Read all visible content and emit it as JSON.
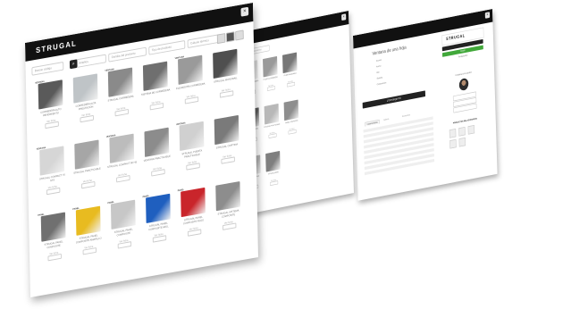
{
  "brand": {
    "logo_text": "STRUGAL",
    "close_glyph": "×"
  },
  "sheet1": {
    "filters": [
      "Buscar código",
      "Amplios",
      "Familia del producto",
      "Tipo de producto",
      "Cálculo térmico"
    ],
    "cards": [
      {
        "tag": "VENTANA",
        "name": "CORREDERA ALTO RENDIMIENTO",
        "sub": "Ver ficha",
        "color": "#5a5a5a"
      },
      {
        "tag": "",
        "name": "CORREDERA ALTA PRESTACIÓN",
        "sub": "Ver ficha",
        "color": "#bfc4c7"
      },
      {
        "tag": "VENTANA",
        "name": "STRUGAL CORREDERA",
        "sub": "Ver ficha",
        "color": "#8a8a8a"
      },
      {
        "tag": "",
        "name": "SISTEMA DE CORREDERA",
        "sub": "Ver ficha",
        "color": "#6f6f6f"
      },
      {
        "tag": "VENTANA",
        "name": "ELEVADORA CORREDERA",
        "sub": "Ver ficha",
        "color": "#9a9a9a"
      },
      {
        "tag": "",
        "name": "STRUGAL MONORAIL",
        "sub": "Ver ficha",
        "color": "#4f4f4f"
      },
      {
        "tag": "VENTANA",
        "name": "STRUGAL COMPACT 70 STS",
        "sub": "Ver ficha",
        "color": "#d6d6d6"
      },
      {
        "tag": "",
        "name": "STRUGAL PRACTICABLE",
        "sub": "Ver ficha",
        "color": "#a6a6a6"
      },
      {
        "tag": "VENTANA",
        "name": "STRUGAL COMPACT 80 HS",
        "sub": "Ver ficha",
        "color": "#bcbcbc"
      },
      {
        "tag": "",
        "name": "VENTANA PRACTICABLE",
        "sub": "Ver ficha",
        "color": "#8c8c8c"
      },
      {
        "tag": "VENTANA",
        "name": "STRUGAL PUERTA PRACTICABLE",
        "sub": "Ver ficha",
        "color": "#d0d0d0"
      },
      {
        "tag": "",
        "name": "STRUGAL CORTINA",
        "sub": "Ver ficha",
        "color": "#7a7a7a"
      },
      {
        "tag": "PANEL",
        "name": "STRUGAL PANEL COMPOSITE",
        "sub": "Ver ficha",
        "color": "#707070"
      },
      {
        "tag": "PANEL",
        "name": "STRUGAL PANEL COMPOSITE AMARILLO",
        "sub": "Ver ficha",
        "color": "#e8bb20"
      },
      {
        "tag": "PANEL",
        "name": "STRUGAL PANEL COMPOSITE",
        "sub": "Ver ficha",
        "color": "#c7c7c7"
      },
      {
        "tag": "PANEL",
        "name": "STRUGAL PANEL COMPOSITE AZUL",
        "sub": "Ver ficha",
        "color": "#1f5fbf"
      },
      {
        "tag": "PANEL",
        "name": "STRUGAL PANEL COMPOSITE ROJO",
        "sub": "Ver ficha",
        "color": "#c9252b"
      },
      {
        "tag": "",
        "name": "STRUGAL SISTEMA COMPOSITE",
        "sub": "Ver ficha",
        "color": "#8d8d8d"
      }
    ]
  },
  "sheet2": {
    "filters": [
      "Tipo de producto",
      "Cálculo térmico"
    ],
    "cards": [
      {
        "tag": "PUERTA",
        "name": "PUERTA STRUGAL",
        "sub": "Ver ficha",
        "color": "#6b4a2d"
      },
      {
        "tag": "",
        "name": "STRUGAL CORREDERA",
        "sub": "Ver ficha",
        "color": "#dcdcdc"
      },
      {
        "tag": "",
        "name": "PUERTA CORREDERA",
        "sub": "Ver ficha",
        "color": "#9a9a9a"
      },
      {
        "tag": "",
        "name": "PUERTA ELEVABLE",
        "sub": "Ver ficha",
        "color": "#777777"
      },
      {
        "tag": "",
        "name": "STRUGAL COMPACT",
        "sub": "Ver ficha",
        "color": "#c8c8c8"
      },
      {
        "tag": "",
        "name": "STRUGAL PUERTA",
        "sub": "Ver ficha",
        "color": "#5d5d5d"
      },
      {
        "tag": "",
        "name": "STRUGAL PRACTICABLE",
        "sub": "Ver ficha",
        "color": "#b8b8b8"
      },
      {
        "tag": "",
        "name": "PANEL COMPOSITE",
        "sub": "Ver ficha",
        "color": "#8e8e8e"
      },
      {
        "tag": "",
        "name": "STRUGAL PANEL",
        "sub": "Ver ficha",
        "color": "#e6b923"
      },
      {
        "tag": "",
        "name": "PANEL AMARILLO",
        "sub": "Ver ficha",
        "color": "#b5b5b5"
      },
      {
        "tag": "",
        "name": "STRUGAL MURO",
        "sub": "Ver ficha",
        "color": "#7f7f7f"
      }
    ]
  },
  "sheet3": {
    "title": "Ventana de una hoja",
    "lines": [
      "Acceso",
      "Ancho",
      "Alto",
      "Sistema",
      "Composición"
    ],
    "download_label": "Descarga CD",
    "tabs": [
      "Características",
      "Galería",
      "Accesorios"
    ],
    "sidebar_buttons": [
      "Añadir",
      "Presupuesto"
    ],
    "contact_title": "Contacta con tu gestor",
    "related_title": "PRODUCTOS RELACIONADOS",
    "accent_color": "#41a83a"
  }
}
